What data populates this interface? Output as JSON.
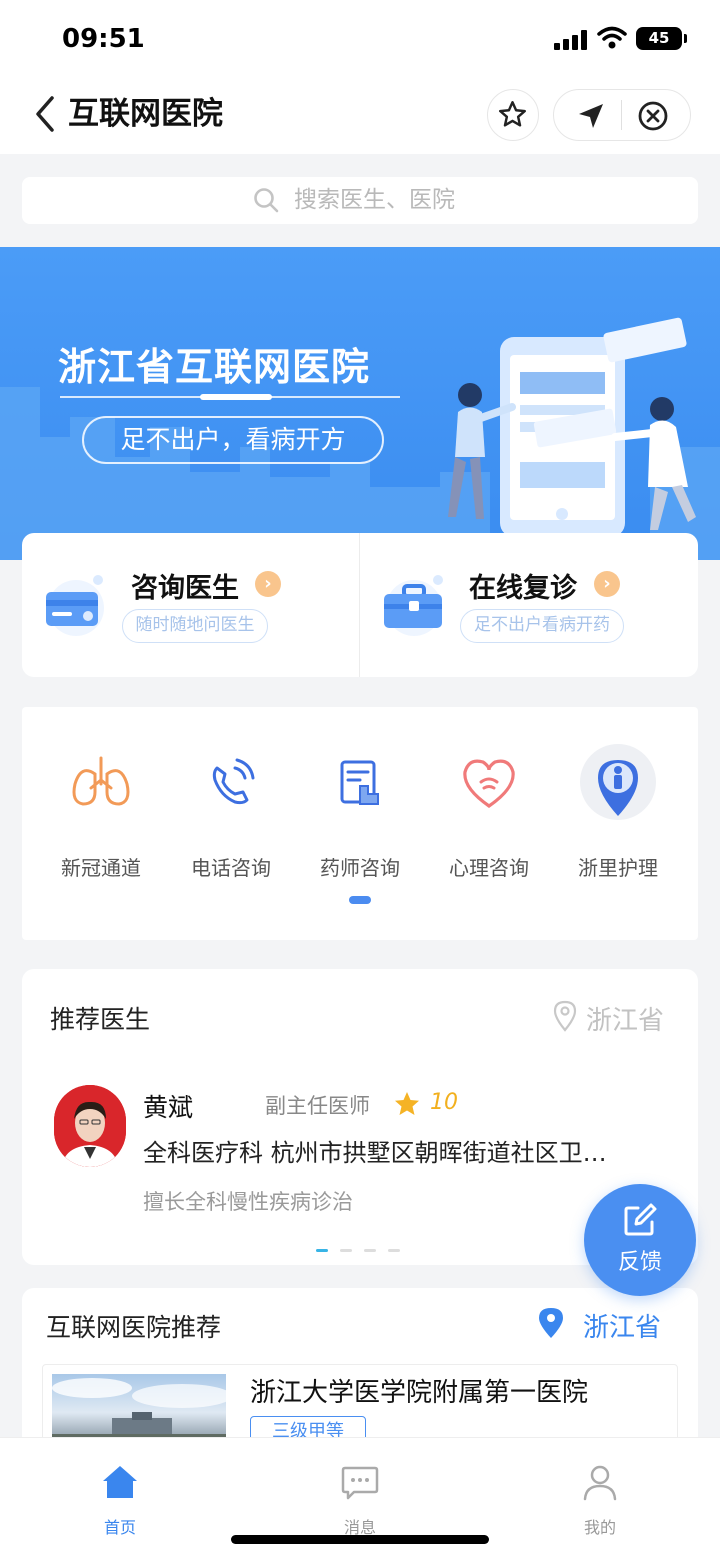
{
  "status_bar": {
    "time": "09:51",
    "battery": "45"
  },
  "nav": {
    "title": "互联网医院"
  },
  "search": {
    "placeholder": "搜索医生、医院"
  },
  "banner": {
    "title": "浙江省互联网医院",
    "slogan": "足不出户，看病开方"
  },
  "services": [
    {
      "title": "咨询医生",
      "subtitle": "随时随地问医生"
    },
    {
      "title": "在线复诊",
      "subtitle": "足不出户看病开药"
    }
  ],
  "quick_entries": [
    {
      "label": "新冠通道",
      "icon": "lungs-icon"
    },
    {
      "label": "电话咨询",
      "icon": "phone-icon"
    },
    {
      "label": "药师咨询",
      "icon": "pharmacist-icon"
    },
    {
      "label": "心理咨询",
      "icon": "heart-icon"
    },
    {
      "label": "浙里护理",
      "icon": "nurse-location-icon"
    }
  ],
  "recommend_doctor": {
    "heading": "推荐医生",
    "location": "浙江省",
    "doctor": {
      "name": "黄斌",
      "title": "副主任医师",
      "score": "10",
      "department": "全科医疗科 杭州市拱墅区朝晖街道社区卫…",
      "specialty": "擅长全科慢性疾病诊治"
    }
  },
  "feedback": {
    "label": "反馈"
  },
  "hospital_recommend": {
    "heading": "互联网医院推荐",
    "location": "浙江省",
    "hospital": {
      "name": "浙江大学医学院附属第一医院",
      "level": "三级甲等"
    }
  },
  "tab_bar": [
    {
      "label": "首页",
      "icon": "home-icon",
      "active": true
    },
    {
      "label": "消息",
      "icon": "message-icon",
      "active": false
    },
    {
      "label": "我的",
      "icon": "user-icon",
      "active": false
    }
  ],
  "colors": {
    "primary": "#3a86ee",
    "banner": "#4b9cf7",
    "accent_orange": "#f9c58d",
    "star": "#f2b01e"
  }
}
